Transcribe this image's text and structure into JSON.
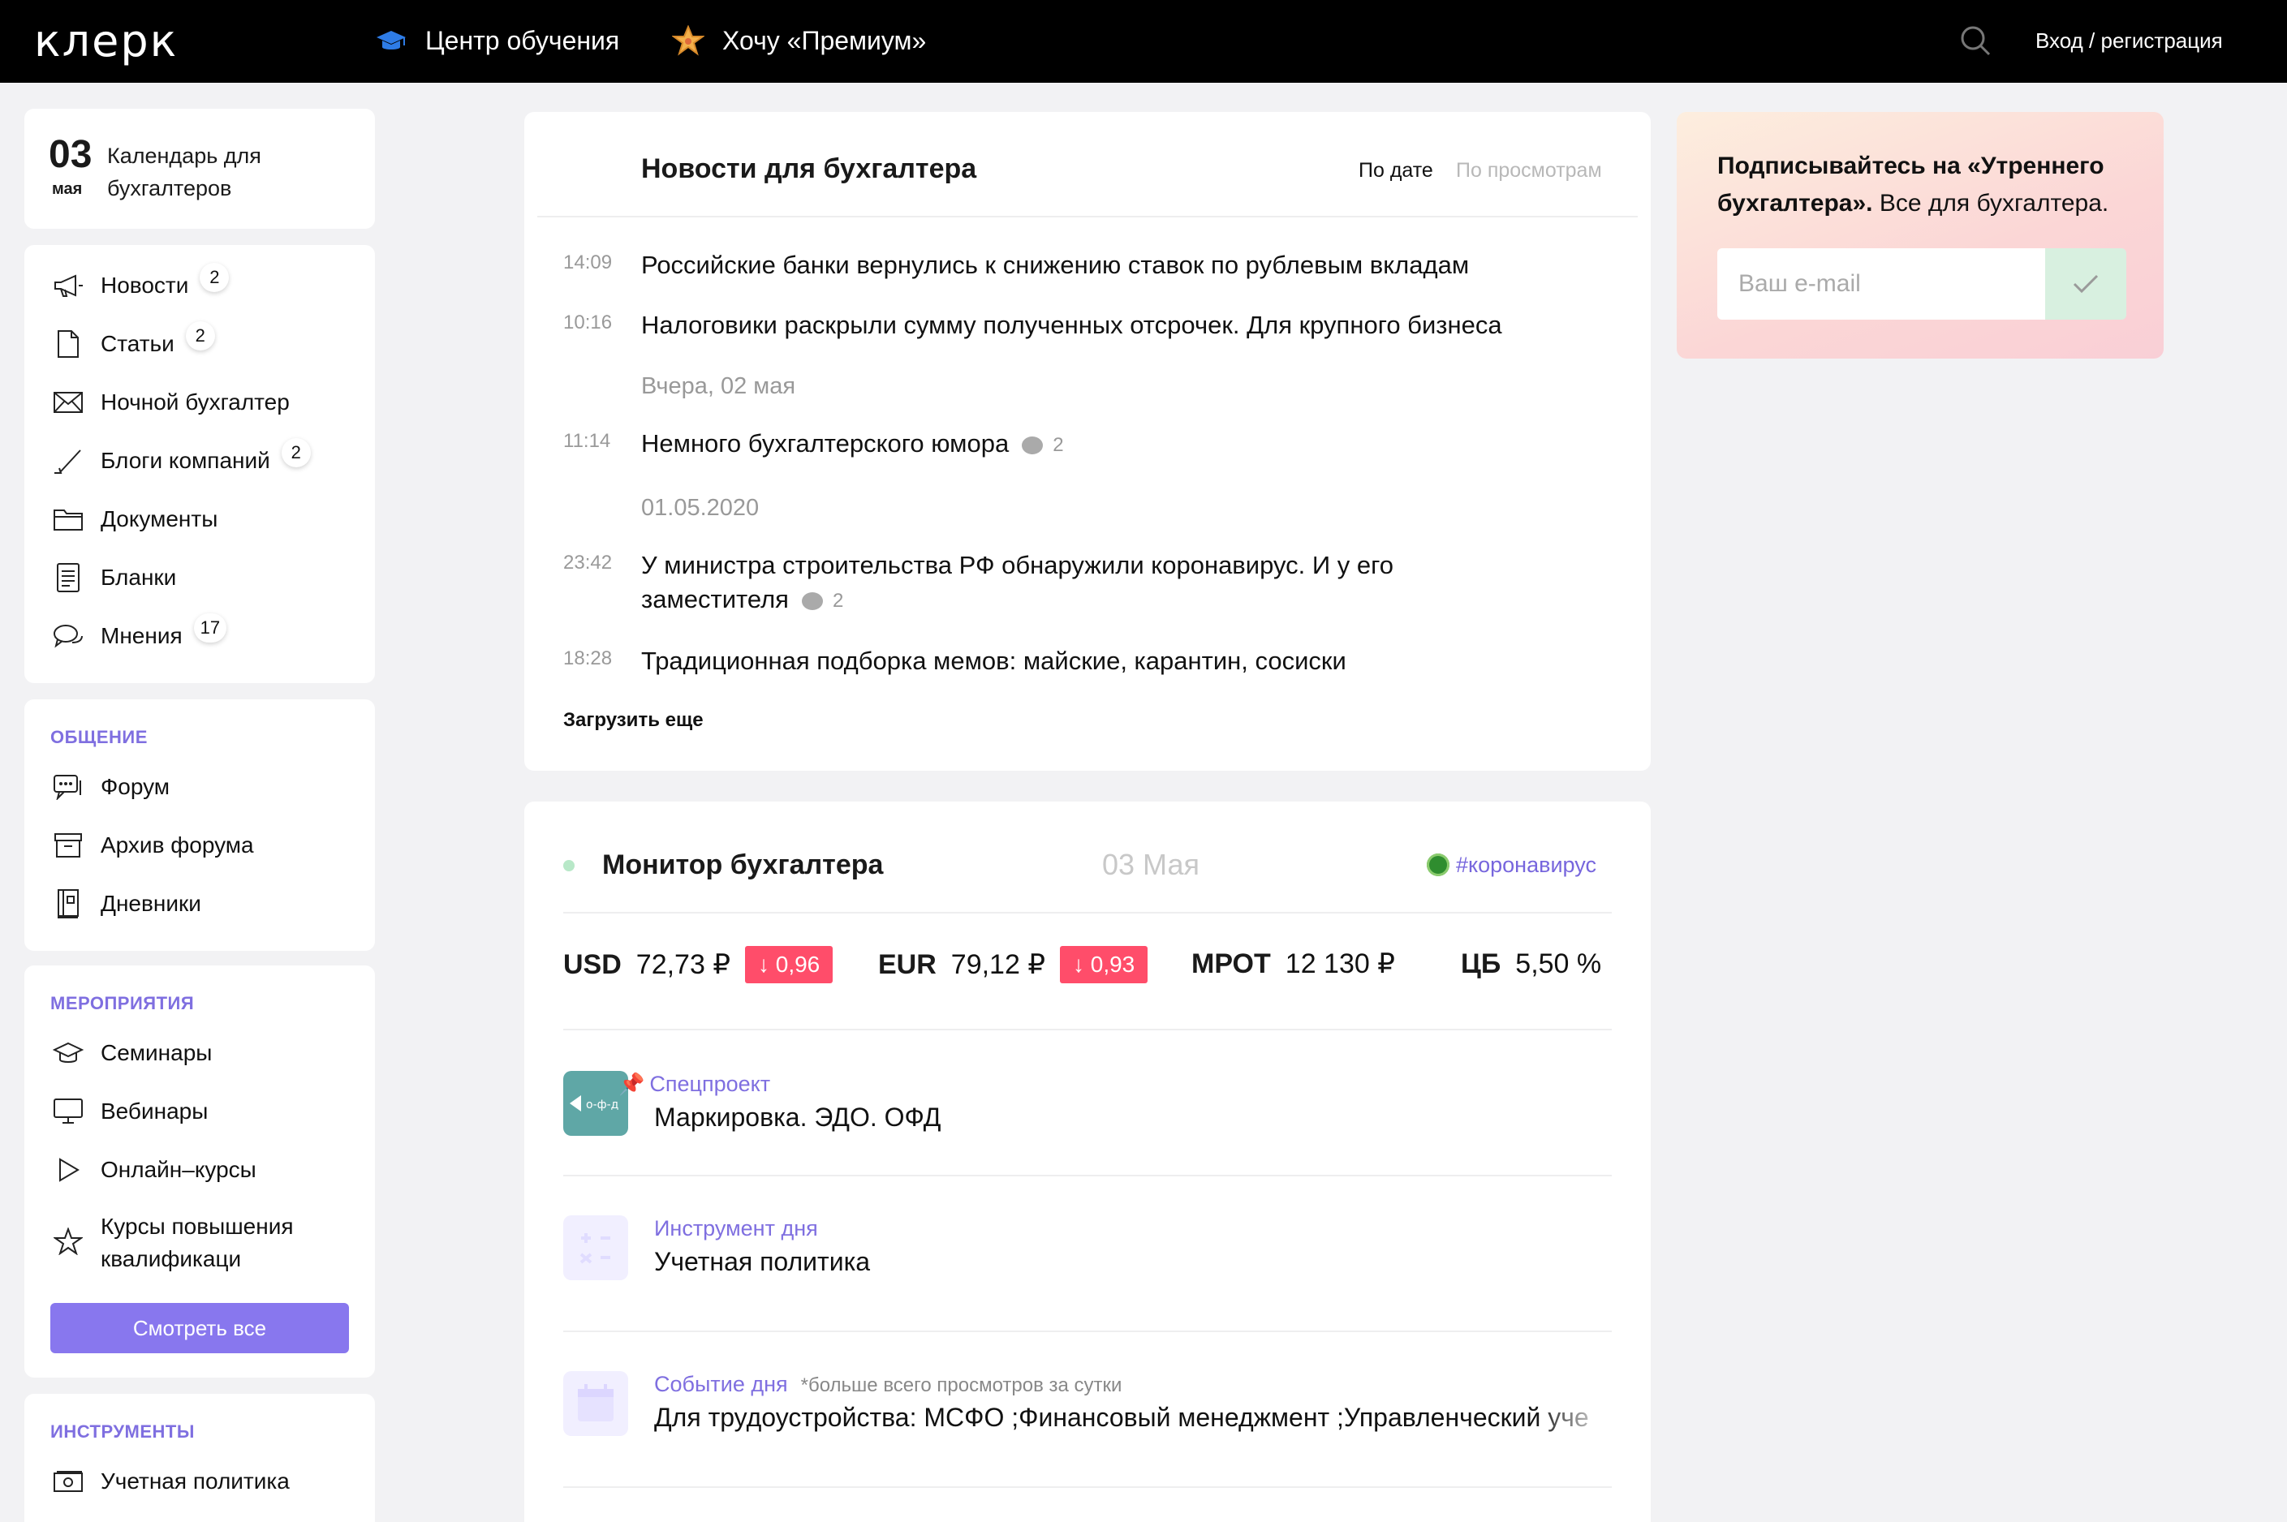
{
  "header": {
    "logo": "клерк",
    "nav": {
      "learning_center": "Центр обучения",
      "premium": "Хочу «Премиум»"
    },
    "login": "Вход / регистрация"
  },
  "calendar": {
    "day": "03",
    "month": "мая",
    "title": "Календарь для бухгалтеров"
  },
  "menu": {
    "items": [
      {
        "label": "Новости",
        "badge": "2",
        "icon": "megaphone-icon"
      },
      {
        "label": "Статьи",
        "badge": "2",
        "icon": "document-icon"
      },
      {
        "label": "Ночной бухгалтер",
        "badge": "",
        "icon": "envelope-icon"
      },
      {
        "label": "Блоги компаний",
        "badge": "2",
        "icon": "pen-icon"
      },
      {
        "label": "Документы",
        "badge": "",
        "icon": "folder-icon"
      },
      {
        "label": "Бланки",
        "badge": "",
        "icon": "form-icon"
      },
      {
        "label": "Мнения",
        "badge": "17",
        "icon": "chat-icon"
      }
    ]
  },
  "communication": {
    "heading": "ОБЩЕНИЕ",
    "items": [
      {
        "label": "Форум",
        "icon": "forum-icon"
      },
      {
        "label": "Архив форума",
        "icon": "archive-icon"
      },
      {
        "label": "Дневники",
        "icon": "diary-icon"
      }
    ]
  },
  "events": {
    "heading": "МЕРОПРИЯТИЯ",
    "items": [
      {
        "label": "Семинары",
        "icon": "graduation-cap-icon"
      },
      {
        "label": "Вебинары",
        "icon": "monitor-icon"
      },
      {
        "label": "Онлайн–курсы",
        "icon": "play-icon"
      },
      {
        "label": "Курсы повышения квалификаци",
        "icon": "star-icon"
      }
    ],
    "see_all": "Смотреть все"
  },
  "tools": {
    "heading": "ИНСТРУМЕНТЫ",
    "items": [
      {
        "label": "Учетная политика",
        "icon": "money-icon"
      }
    ]
  },
  "news": {
    "title": "Новости для бухгалтера",
    "sort_date": "По дате",
    "sort_views": "По просмотрам",
    "items": [
      {
        "time": "14:09",
        "text": "Российские банки вернулись к снижению ставок по рублевым вкладам",
        "comments": ""
      },
      {
        "time": "10:16",
        "text": "Налоговики раскрыли сумму полученных отсрочек. Для крупного бизнеса",
        "comments": ""
      },
      {
        "time": "11:14",
        "text": "Немного бухгалтерского юмора",
        "comments": "2"
      },
      {
        "time": "23:42",
        "text": "У министра строительства РФ обнаружили коронавирус. И у его заместителя",
        "comments": "2"
      },
      {
        "time": "18:28",
        "text": "Традиционная подборка мемов: майские, карантин, сосиски",
        "comments": ""
      }
    ],
    "date_separators": [
      "Вчера, 02 мая",
      "01.05.2020"
    ],
    "load_more": "Загрузить еще"
  },
  "monitor": {
    "title": "Монитор бухгалтера",
    "date": "03 Мая",
    "tag": "#коронавирус",
    "rates": [
      {
        "code": "USD",
        "value": "72,73 ₽",
        "delta": "↓ 0,96"
      },
      {
        "code": "EUR",
        "value": "79,12 ₽",
        "delta": "↓ 0,93"
      },
      {
        "code": "МРОТ",
        "value": "12 130 ₽",
        "delta": ""
      },
      {
        "code": "ЦБ",
        "value": "5,50 %",
        "delta": ""
      }
    ],
    "features": [
      {
        "label": "Спецпроект",
        "text": "Маркировка. ЭДО. ОФД",
        "note": ""
      },
      {
        "label": "Инструмент дня",
        "text": "Учетная политика",
        "note": ""
      },
      {
        "label": "Событие дня",
        "text": "Для трудоустройства: МСФО ;Финансовый менеджмент ;Управленческий уче",
        "note": "*больше всего просмотров за сутки"
      }
    ]
  },
  "subscribe": {
    "text_bold": "Подписывайтесь на «Утреннего бухгалтера».",
    "text_rest": " Все для бухгалтера.",
    "placeholder": "Ваш e-mail"
  },
  "colors": {
    "accent": "#8877ee",
    "accent_text": "#7f6fe0",
    "negative": "#ff4d6a",
    "header_bg": "#000000"
  }
}
